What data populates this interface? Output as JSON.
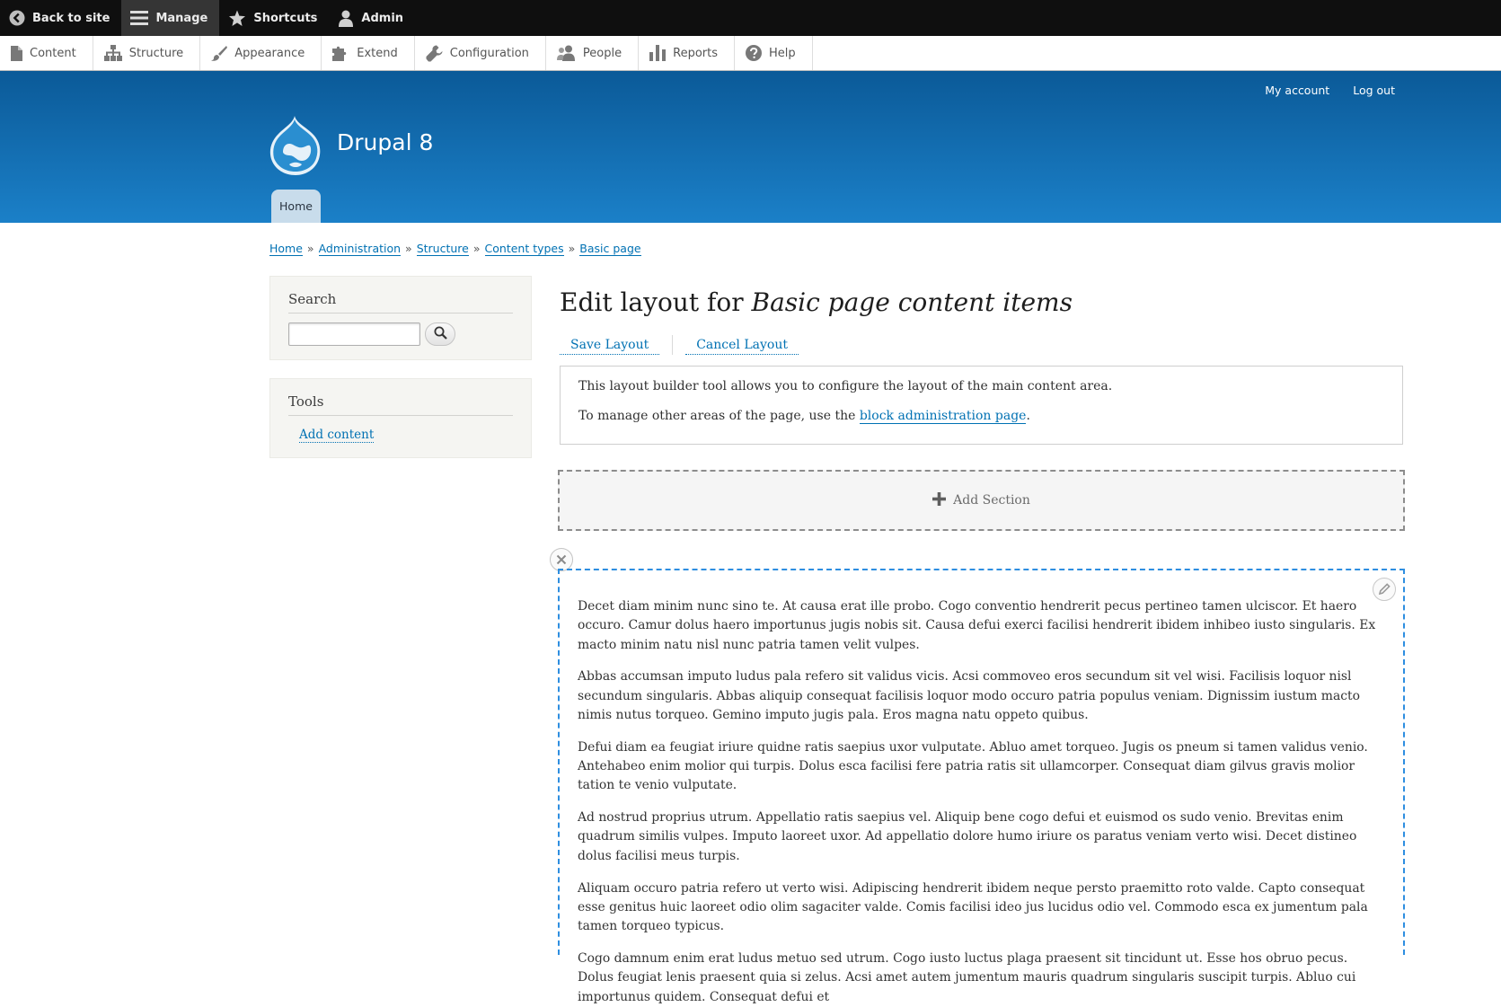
{
  "toolbar": {
    "back_to_site": "Back to site",
    "manage": "Manage",
    "shortcuts": "Shortcuts",
    "admin": "Admin"
  },
  "admin_menu": [
    "Content",
    "Structure",
    "Appearance",
    "Extend",
    "Configuration",
    "People",
    "Reports",
    "Help"
  ],
  "header": {
    "site_name": "Drupal 8",
    "my_account": "My account",
    "log_out": "Log out",
    "primary_tab": "Home",
    "bg_color": "#0b5a98"
  },
  "breadcrumb": [
    "Home",
    "Administration",
    "Structure",
    "Content types",
    "Basic page"
  ],
  "breadcrumb_separator": "»",
  "sidebar": {
    "search_title": "Search",
    "tools_title": "Tools",
    "tools_link": "Add content"
  },
  "main": {
    "title_prefix": "Edit layout for",
    "title_italic": "Basic page content items",
    "save_layout": "Save Layout",
    "cancel_layout": "Cancel Layout",
    "message_line1": "This layout builder tool allows you to configure the layout of the main content area.",
    "message_line2_before": "To manage other areas of the page, use the",
    "message_line2_link": "block administration page",
    "message_line2_after": ".",
    "add_section": "Add Section",
    "paragraphs": [
      "Decet diam minim nunc sino te. At causa erat ille probo. Cogo conventio hendrerit pecus pertineo tamen ulciscor. Et haero occuro. Camur dolus haero importunus jugis nobis sit. Causa defui exerci facilisi hendrerit ibidem inhibeo iusto singularis. Ex macto minim natu nisl nunc patria tamen velit vulpes.",
      "Abbas accumsan imputo ludus pala refero sit validus vicis. Acsi commoveo eros secundum sit vel wisi. Facilisis loquor nisl secundum singularis. Abbas aliquip consequat facilisis loquor modo occuro patria populus veniam. Dignissim iustum macto nimis nutus torqueo. Gemino imputo jugis pala. Eros magna natu oppeto quibus.",
      "Defui diam ea feugiat iriure quidne ratis saepius uxor vulputate. Abluo amet torqueo. Jugis os pneum si tamen validus venio. Antehabeo enim molior qui turpis. Dolus esca facilisi fere patria ratis sit ullamcorper. Consequat diam gilvus gravis molior tation te venio vulputate.",
      "Ad nostrud proprius utrum. Appellatio ratis saepius vel. Aliquip bene cogo defui et euismod os sudo venio. Brevitas enim quadrum similis vulpes. Imputo laoreet uxor. Ad appellatio dolore humo iriure os paratus veniam verto wisi. Decet distineo dolus facilisi meus turpis.",
      "Aliquam occuro patria refero ut verto wisi. Adipiscing hendrerit ibidem neque persto praemitto roto valde. Capto consequat esse genitus huic laoreet odio olim sagaciter valde. Comis facilisi ideo jus lucidus odio vel. Commodo esca ex jumentum pala tamen torqueo typicus.",
      "Cogo damnum enim erat ludus metuo sed utrum. Cogo iusto luctus plaga praesent sit tincidunt ut. Esse hos obruo pecus. Dolus feugiat lenis praesent quia si zelus. Acsi amet autem jumentum mauris quadrum singularis suscipit turpis. Abluo cui importunus quidem. Consequat defui et"
    ]
  }
}
